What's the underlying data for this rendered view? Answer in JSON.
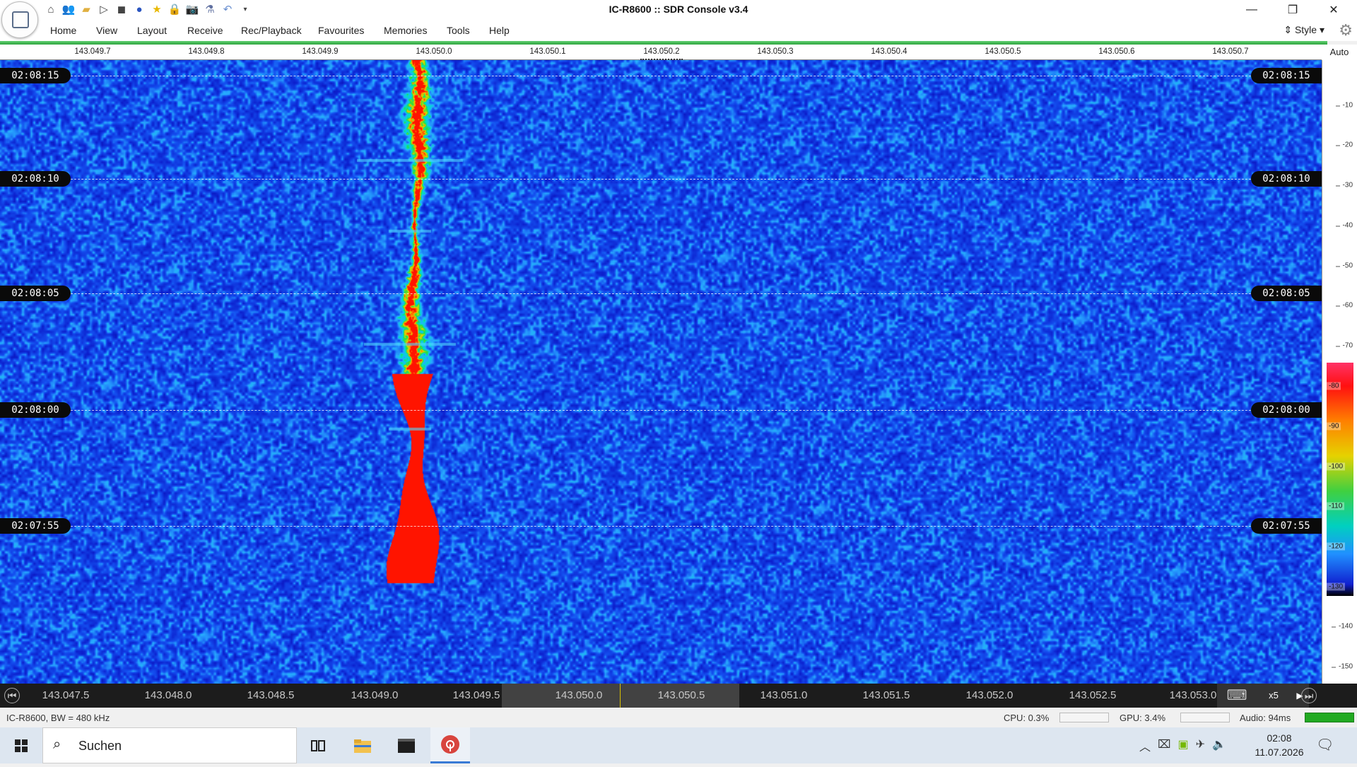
{
  "window": {
    "title": "IC-R8600 :: SDR Console v3.4",
    "minimize": "—",
    "restore": "❐",
    "close": "✕"
  },
  "quick_tools": [
    "home-icon",
    "users-icon",
    "folder-icon",
    "play-icon",
    "stop-icon",
    "record-icon",
    "star-icon",
    "lock-icon",
    "camera-icon",
    "flask-icon",
    "undo-icon",
    "dropdown-icon"
  ],
  "menu": {
    "items": [
      "Home",
      "View",
      "Layout",
      "Receive",
      "Rec/Playback",
      "Favourites",
      "Memories",
      "Tools",
      "Help"
    ],
    "style_label": "Style"
  },
  "frequency_scale": {
    "labels": [
      "143.049.7",
      "143.049.8",
      "143.049.9",
      "143.050.0",
      "143.050.1",
      "143.050.2",
      "143.050.3",
      "143.050.4",
      "143.050.5",
      "143.050.6",
      "143.050.7"
    ],
    "auto_label": "Auto"
  },
  "waterfall": {
    "timestamps": [
      "02:08:15",
      "02:08:10",
      "02:08:05",
      "02:08:00",
      "02:07:55"
    ],
    "signal_frequency": "143.050.0",
    "colors": {
      "background": "#0c1ecc",
      "noise": "#2c8cff",
      "peak": "#ff2000"
    }
  },
  "db_scale": {
    "labels": [
      "-10",
      "-20",
      "-30",
      "-40",
      "-50",
      "-60",
      "-70",
      "-80",
      "-90",
      "-100",
      "-110",
      "-120",
      "-130",
      "-140",
      "-150"
    ],
    "gradient_labels": [
      "-80",
      "-90",
      "-100",
      "-110",
      "-120",
      "-130"
    ]
  },
  "bottom_scale": {
    "labels": [
      "143.047.5",
      "143.048.0",
      "143.048.5",
      "143.049.0",
      "143.049.5",
      "143.050.0",
      "143.050.5",
      "143.051.0",
      "143.051.5",
      "143.052.0",
      "143.052.5",
      "143.053.0"
    ],
    "zoom": "x5"
  },
  "status": {
    "device": "IC-R8600, BW = 480 kHz",
    "cpu": "CPU: 0.3%",
    "gpu": "GPU: 3.4%",
    "audio": "Audio: 94ms",
    "audio_level_color": "#22aa22"
  },
  "taskbar": {
    "search_placeholder": "Suchen",
    "time": "02:08",
    "date": "11.07.2026"
  }
}
